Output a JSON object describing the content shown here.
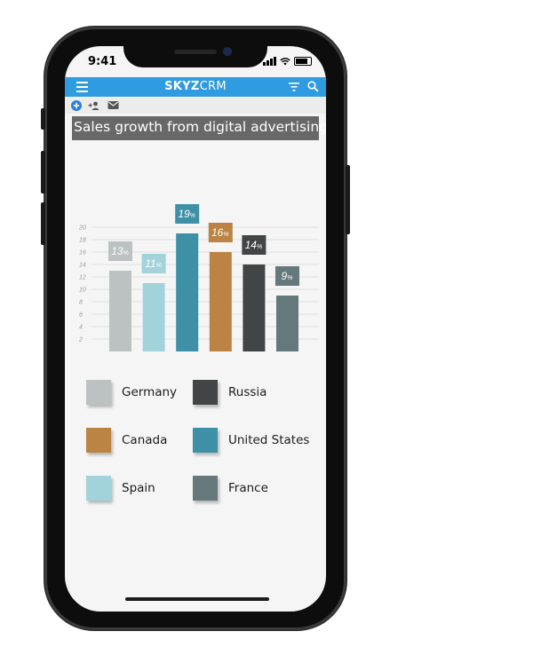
{
  "status": {
    "time": "9:41"
  },
  "appbar": {
    "brand_bold": "SKYZ",
    "brand_regular": "CRM"
  },
  "icons": {
    "menu": "menu-icon",
    "filter": "filter-icon",
    "search": "search-icon",
    "add": "add-circle-icon",
    "add_user": "add-user-icon",
    "mail": "mail-icon"
  },
  "colors": {
    "appbar": "#2f9be0",
    "title_bg": "#686868",
    "germany": "#bcc2c1",
    "spain": "#a2d3da",
    "united_states": "#3e90a6",
    "canada": "#bb8344",
    "russia": "#414545",
    "france": "#65787c"
  },
  "chart_data": {
    "type": "bar",
    "title": "Sales growth from digital advertising",
    "categories": [
      "Germany",
      "Spain",
      "United States",
      "Canada",
      "Russia",
      "France"
    ],
    "values": [
      13,
      11,
      19,
      16,
      14,
      9
    ],
    "value_suffix": "%",
    "ylim": [
      0,
      20
    ],
    "yticks": [
      2,
      4,
      6,
      8,
      10,
      12,
      14,
      16,
      18,
      20
    ],
    "grid": true,
    "legend": "bottom, two columns",
    "legend_entries": [
      {
        "label": "Germany",
        "color": "#bcc2c1"
      },
      {
        "label": "Russia",
        "color": "#414545"
      },
      {
        "label": "Canada",
        "color": "#bb8344"
      },
      {
        "label": "United States",
        "color": "#3e90a6"
      },
      {
        "label": "Spain",
        "color": "#a2d3da"
      },
      {
        "label": "France",
        "color": "#65787c"
      }
    ]
  }
}
